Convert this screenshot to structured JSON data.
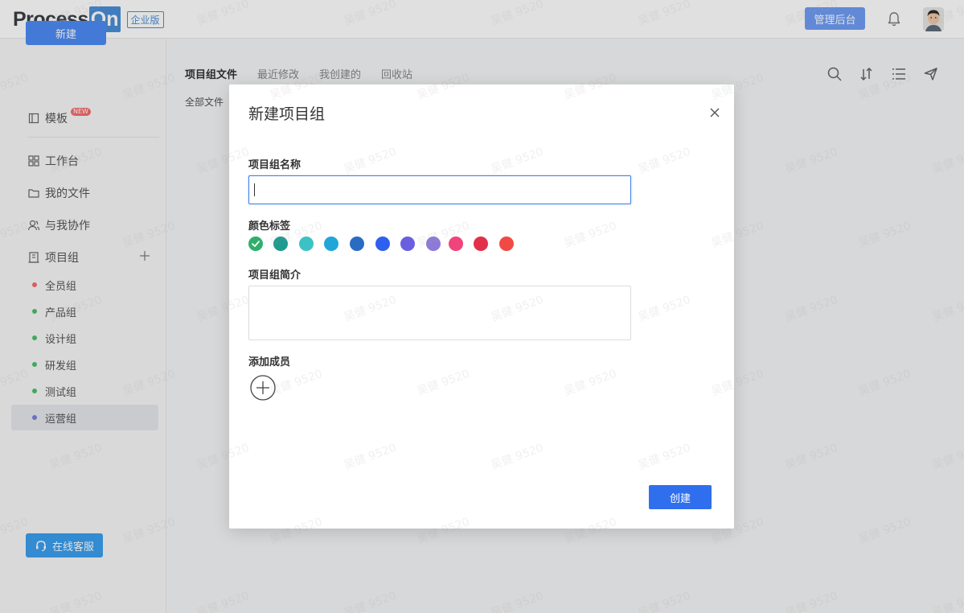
{
  "header": {
    "logo_process": "Process",
    "logo_on": "On",
    "edition": "企业版",
    "admin_button": "管理后台"
  },
  "sidebar": {
    "new_button": "新建",
    "template_label": "模板",
    "template_badge": "NEW",
    "nav": [
      {
        "label": "工作台"
      },
      {
        "label": "我的文件"
      },
      {
        "label": "与我协作"
      },
      {
        "label": "项目组"
      }
    ],
    "groups": [
      {
        "label": "全员组",
        "color": "#f56c6c"
      },
      {
        "label": "产品组",
        "color": "#49c168"
      },
      {
        "label": "设计组",
        "color": "#49c168"
      },
      {
        "label": "研发组",
        "color": "#49c168"
      },
      {
        "label": "测试组",
        "color": "#49c168"
      },
      {
        "label": "运营组",
        "color": "#7b7fe0"
      }
    ],
    "service_button": "在线客服"
  },
  "main": {
    "tabs": [
      {
        "label": "项目组文件",
        "active": true
      },
      {
        "label": "最近修改",
        "active": false
      },
      {
        "label": "我创建的",
        "active": false
      },
      {
        "label": "回收站",
        "active": false
      }
    ],
    "breadcrumb": "全部文件",
    "tools": [
      "search-icon",
      "sort-icon",
      "list-view-icon",
      "send-icon"
    ]
  },
  "modal": {
    "title": "新建项目组",
    "name_label": "项目组名称",
    "name_value": "",
    "color_label": "颜色标签",
    "colors": [
      "#2fb06a",
      "#1f9a8f",
      "#3cc2c4",
      "#21a6d8",
      "#2a6cc4",
      "#2f5ff0",
      "#6a5fe0",
      "#8d7ad8",
      "#f0447c",
      "#e3304a",
      "#f14a44"
    ],
    "selected_color": "#2fb06a",
    "desc_label": "项目组简介",
    "desc_value": "",
    "member_label": "添加成员",
    "create_button": "创建"
  },
  "watermark": "吴健 9520"
}
